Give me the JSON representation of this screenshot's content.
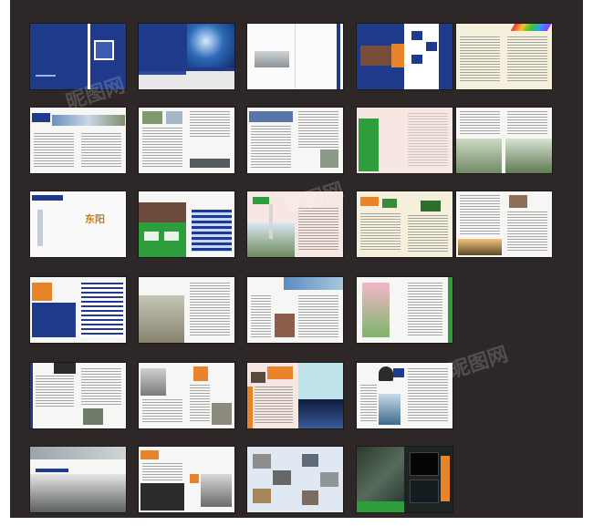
{
  "page": {
    "background": "#2d2827",
    "thumbnail_count": 27,
    "watermark_text": "昵图网",
    "colors": {
      "navy": "#1f3a8a",
      "orange": "#e8842a",
      "green": "#2e9e3c",
      "gray_text": "#8a8a8a",
      "blush": "#f7e7e3"
    }
  },
  "spreads": [
    {
      "id": "p1",
      "style": "navy-cover",
      "label": ""
    },
    {
      "id": "p2",
      "style": "navy-photo",
      "label": ""
    },
    {
      "id": "p3",
      "style": "white-building",
      "label": ""
    },
    {
      "id": "p4",
      "style": "navy-orange-grid",
      "label": ""
    },
    {
      "id": "p5",
      "style": "text-rainbow",
      "label": ""
    },
    {
      "id": "p6",
      "style": "text-photo-band",
      "label": ""
    },
    {
      "id": "p7",
      "style": "text-photos",
      "label": ""
    },
    {
      "id": "p8",
      "style": "text-photos",
      "label": ""
    },
    {
      "id": "p9",
      "style": "green-block",
      "label": ""
    },
    {
      "id": "p10",
      "style": "text-photos",
      "label": ""
    },
    {
      "id": "p11",
      "style": "calligraphy-cover",
      "label": "东阳"
    },
    {
      "id": "p12",
      "style": "green-table",
      "label": ""
    },
    {
      "id": "p13",
      "style": "blush-tower",
      "label": ""
    },
    {
      "id": "p14",
      "style": "text-photos",
      "label": ""
    },
    {
      "id": "p15",
      "style": "text-photos",
      "label": ""
    },
    {
      "id": "p16",
      "style": "table-orange",
      "label": ""
    },
    {
      "id": "p17",
      "style": "text-road",
      "label": ""
    },
    {
      "id": "p18",
      "style": "text-photos",
      "label": ""
    },
    {
      "id": "p19",
      "style": "tulip",
      "label": ""
    },
    {
      "id": "p20",
      "style": "text-photos",
      "label": ""
    },
    {
      "id": "p21",
      "style": "text-photos",
      "label": ""
    },
    {
      "id": "p22",
      "style": "orange-cyan",
      "label": ""
    },
    {
      "id": "p23",
      "style": "portrait-text",
      "label": ""
    },
    {
      "id": "p24",
      "style": "campus-collage",
      "label": ""
    },
    {
      "id": "p25",
      "style": "text-collage",
      "label": ""
    },
    {
      "id": "p26",
      "style": "gray-boxes",
      "label": ""
    },
    {
      "id": "p27",
      "style": "dark-collage",
      "label": ""
    }
  ]
}
